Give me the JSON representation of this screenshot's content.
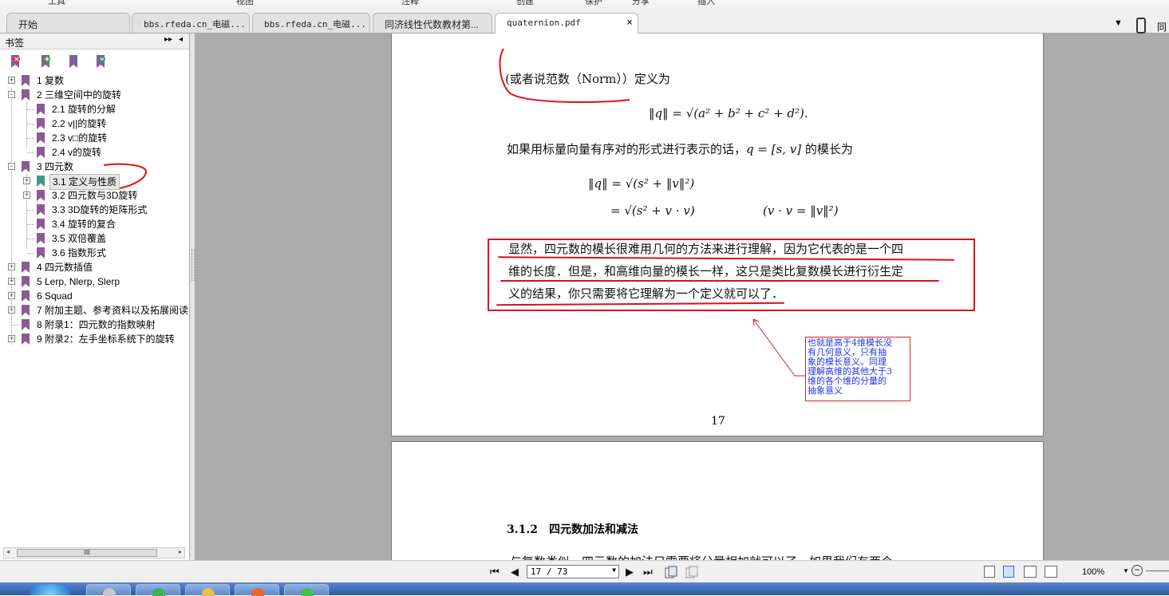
{
  "ribbon": {
    "items": [
      "工具",
      "视图",
      "注释",
      "创建",
      "保护",
      "分享",
      "插入"
    ]
  },
  "tabs": [
    {
      "label": "开始",
      "active": false
    },
    {
      "label": "bbs.rfeda.cn_电磁...",
      "active": false
    },
    {
      "label": "bbs.rfeda.cn_电磁...",
      "active": false
    },
    {
      "label": "同济线性代数教材第...",
      "active": false
    },
    {
      "label": "quaternion.pdf",
      "active": true
    }
  ],
  "tab_close": "×",
  "tab_dropdown": "▼",
  "sync_label": "同步",
  "sidebar": {
    "title": "书签",
    "pin": "▸▸",
    "collapse": "◂",
    "tools": [
      "delete-bookmark-icon",
      "add-bookmark-icon",
      "go-to-bookmark-icon",
      "expand-bookmarks-icon"
    ],
    "items": [
      {
        "label": "1 复数",
        "level": 0,
        "expander": "+"
      },
      {
        "label": "2 三维空间中的旋转",
        "level": 0,
        "expander": "-"
      },
      {
        "label": "2.1 旋转的分解",
        "level": 1,
        "expander": ""
      },
      {
        "label": "2.2 v||的旋转",
        "level": 1,
        "expander": ""
      },
      {
        "label": "2.3 v□的旋转",
        "level": 1,
        "expander": ""
      },
      {
        "label": "2.4 v的旋转",
        "level": 1,
        "expander": ""
      },
      {
        "label": "3 四元数",
        "level": 0,
        "expander": "-"
      },
      {
        "label": "3.1 定义与性质",
        "level": 1,
        "expander": "+",
        "selected": true
      },
      {
        "label": "3.2 四元数与3D旋转",
        "level": 1,
        "expander": "+"
      },
      {
        "label": "3.3 3D旋转的矩阵形式",
        "level": 1,
        "expander": ""
      },
      {
        "label": "3.4 旋转的复合",
        "level": 1,
        "expander": ""
      },
      {
        "label": "3.5 双倍覆盖",
        "level": 1,
        "expander": ""
      },
      {
        "label": "3.6 指数形式",
        "level": 1,
        "expander": ""
      },
      {
        "label": "4 四元数插值",
        "level": 0,
        "expander": "+"
      },
      {
        "label": "5 Lerp, Nlerp, Slerp",
        "level": 0,
        "expander": "+"
      },
      {
        "label": "6 Squad",
        "level": 0,
        "expander": "+"
      },
      {
        "label": "7 附加主题、参考资料以及拓展阅读",
        "level": 0,
        "expander": "+"
      },
      {
        "label": "8 附录1：四元数的指数映射",
        "level": 0,
        "expander": ""
      },
      {
        "label": "9 附录2：左手坐标系统下的旋转",
        "level": 0,
        "expander": "+"
      }
    ],
    "scroll_grip": "III"
  },
  "document": {
    "page17": {
      "intro_line": "(或者说范数（Norm））定义为",
      "norm_formula": "‖q‖ = √(a² + b² + c² + d²).",
      "vector_line": "如果用标量向量有序对的形式进行表示的话，",
      "vector_line_math": "q = [s, v]",
      "vector_line_end": "的模长为",
      "eq1": "‖q‖ = √(s² + ‖v‖²)",
      "eq2": "= √(s² + v · v)",
      "eq2_note": "(v · v = ‖v‖²)",
      "boxed_lines": [
        "显然，四元数的模长很难用几何的方法来进行理解，因为它代表的是一个四",
        "维的长度．但是，和高维向量的模长一样，这只是类比复数模长进行衍生定",
        "义的结果，你只需要将它理解为一个定义就可以了．"
      ],
      "annotation": "也就是高于4维模长没\n有几何意义，只有抽\n象的模长意义。同理\n理解高维的其他大于3\n维的各个维的分量的\n抽象意义",
      "page_number": "17"
    },
    "page18": {
      "heading": "3.1.2　四元数加法和减法",
      "partial_line": "与复数类似，四元数的加法只需要将分量相加就可以了．如果我们有两个"
    }
  },
  "navbar": {
    "first": "⏮",
    "prev": "◀",
    "page_value": "17 / 73",
    "next": "▶",
    "last": "⏭",
    "zoom": "100%",
    "zoom_dropdown": "▼",
    "zoom_out": "−"
  },
  "colors": {
    "accent_red": "#e0101e",
    "annotation_text": "#2233ee",
    "bookmark_purple": "#8b5a95",
    "bookmark_selected": "#3a9a8a",
    "doc_background": "#ababab"
  }
}
